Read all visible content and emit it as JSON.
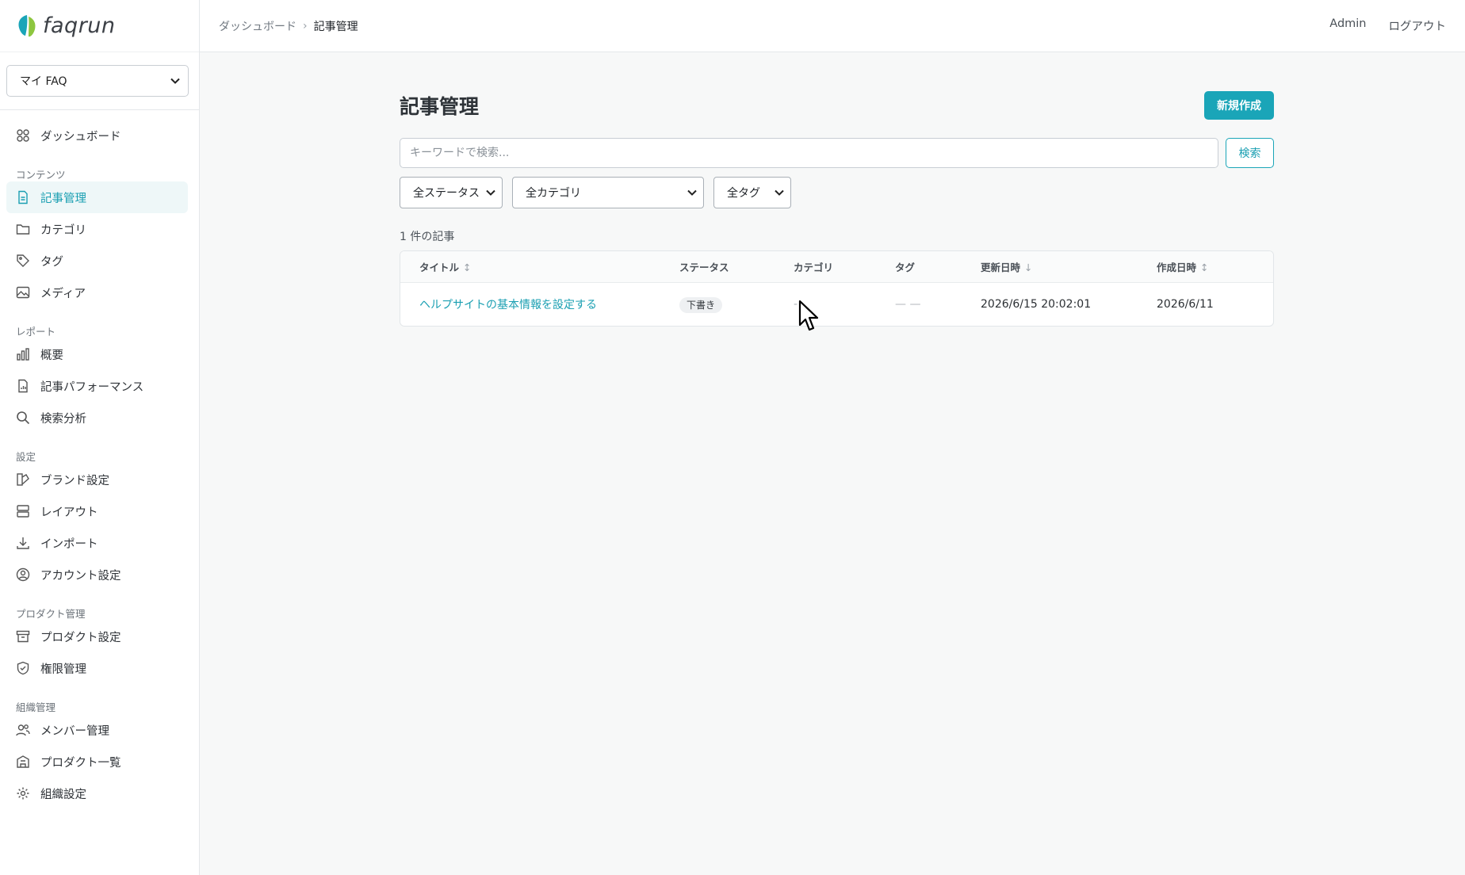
{
  "brand": {
    "name": "faqrun"
  },
  "faq_selector": {
    "value": "マイ FAQ"
  },
  "nav": {
    "dashboard": "ダッシュボード",
    "sections": {
      "content": "コンテンツ",
      "report": "レポート",
      "settings": "設定",
      "product_admin": "プロダクト管理",
      "org_admin": "組織管理"
    },
    "items": {
      "articles": "記事管理",
      "categories": "カテゴリ",
      "tags": "タグ",
      "media": "メディア",
      "overview": "概要",
      "article_performance": "記事パフォーマンス",
      "search_analytics": "検索分析",
      "brand_settings": "ブランド設定",
      "layout": "レイアウト",
      "import": "インポート",
      "account_settings": "アカウント設定",
      "product_settings": "プロダクト設定",
      "permissions": "権限管理",
      "members": "メンバー管理",
      "product_list": "プロダクト一覧",
      "org_settings": "組織設定"
    }
  },
  "breadcrumb": {
    "parent": "ダッシュボード",
    "current": "記事管理"
  },
  "topbar": {
    "user": "Admin",
    "logout": "ログアウト"
  },
  "page": {
    "title": "記事管理",
    "new_button": "新規作成",
    "search_placeholder": "キーワードで検索...",
    "search_button": "検索",
    "filters": {
      "status": "全ステータス",
      "category": "全カテゴリ",
      "tag": "全タグ"
    },
    "count": "1 件の記事"
  },
  "table": {
    "headers": {
      "title": "タイトル",
      "status": "ステータス",
      "category": "カテゴリ",
      "tag": "タグ",
      "updated": "更新日時",
      "created": "作成日時"
    },
    "sort_icons": {
      "title": "↕",
      "updated": "↓",
      "created": "↕"
    },
    "rows": [
      {
        "title": "ヘルプサイトの基本情報を設定する",
        "status": "下書き",
        "category": "-",
        "tag": "— —",
        "updated": "2026/6/15 20:02:01",
        "created": "2026/6/11"
      }
    ]
  },
  "colors": {
    "accent": "#1aa5b8",
    "active_bg": "#eef7f8"
  }
}
